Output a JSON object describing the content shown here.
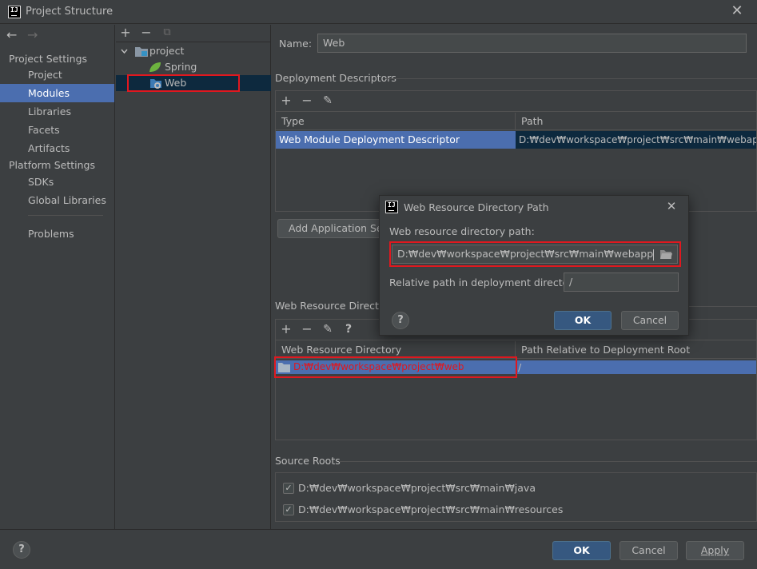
{
  "window": {
    "title": "Project Structure",
    "close_glyph": "✕"
  },
  "nav": {
    "back_glyph": "←",
    "forward_glyph": "→",
    "project_settings_header": "Project Settings",
    "project_settings": [
      "Project",
      "Modules",
      "Libraries",
      "Facets",
      "Artifacts"
    ],
    "platform_settings_header": "Platform Settings",
    "platform_settings": [
      "SDKs",
      "Global Libraries"
    ],
    "problems": "Problems",
    "selected": "Modules"
  },
  "tree": {
    "toolbar": {
      "add": "+",
      "remove": "−",
      "copy": "⧉"
    },
    "root": "project",
    "children": [
      "Spring",
      "Web"
    ],
    "selected": "Web"
  },
  "module": {
    "name_label": "Name:",
    "name_value": "Web"
  },
  "deployment_descriptors": {
    "title": "Deployment Descriptors",
    "toolbar": {
      "add": "+",
      "remove": "−",
      "edit": "✎"
    },
    "columns": [
      "Type",
      "Path"
    ],
    "rows": [
      {
        "type": "Web Module Deployment Descriptor",
        "path": "D:₩dev₩workspace₩project₩src₩main₩webapp₩WEB"
      }
    ],
    "add_server_button": "Add Application Serv"
  },
  "web_resource_directories": {
    "title": "Web Resource Directorie",
    "toolbar": {
      "add": "+",
      "remove": "−",
      "edit": "✎",
      "help": "?"
    },
    "columns": [
      "Web Resource Directory",
      "Path Relative to Deployment Root"
    ],
    "rows": [
      {
        "directory": "D:₩dev₩workspace₩project₩web",
        "relative": "/"
      }
    ]
  },
  "source_roots": {
    "title": "Source Roots",
    "items": [
      {
        "path": "D:₩dev₩workspace₩project₩src₩main₩java",
        "checked": true
      },
      {
        "path": "D:₩dev₩workspace₩project₩src₩main₩resources",
        "checked": true
      }
    ]
  },
  "dialog": {
    "title": "Web Resource Directory Path",
    "close_glyph": "✕",
    "path_label": "Web resource directory path:",
    "path_value": "D:₩dev₩workspace₩project₩src₩main₩webapp",
    "relative_label": "Relative path in deployment directory:",
    "relative_value": "/",
    "ok": "OK",
    "cancel": "Cancel",
    "help": "?"
  },
  "footer": {
    "help": "?",
    "ok": "OK",
    "cancel": "Cancel",
    "apply": "Apply"
  },
  "colors": {
    "background": "#3c3f41",
    "selection": "#4b6eaf",
    "highlight_box": "#e0181f",
    "primary_button": "#365880"
  }
}
